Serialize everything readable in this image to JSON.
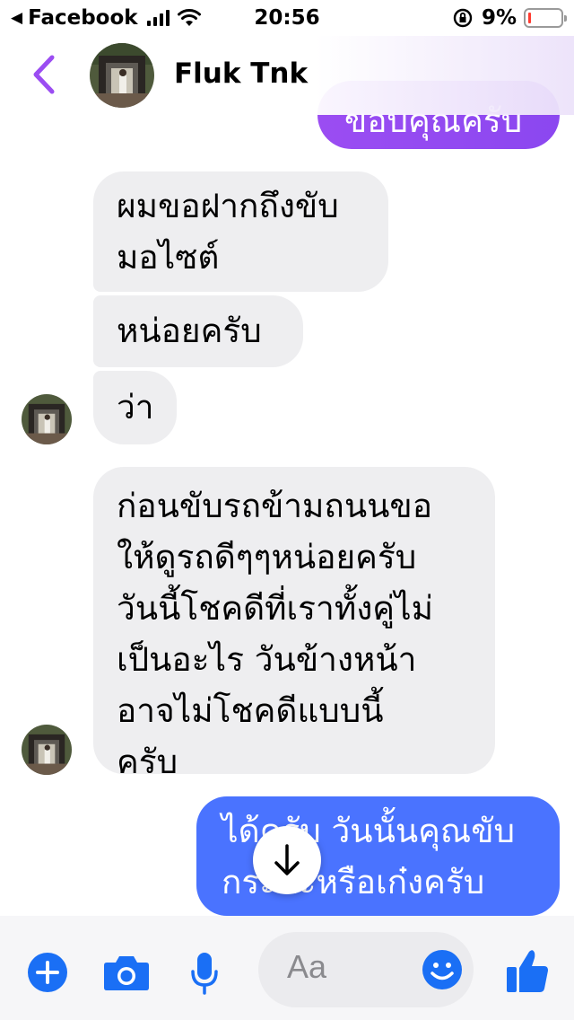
{
  "status_bar": {
    "carrier": "Facebook",
    "time": "20:56",
    "battery_percent": "9%",
    "battery_level": 0.09
  },
  "header": {
    "contact_name": "Fluk Tnk",
    "icons": {
      "back": "chevron-left-icon"
    }
  },
  "messages": [
    {
      "sender": "me",
      "text": "ขอบคุณครับ"
    },
    {
      "sender": "contact",
      "text": "ผมขอฝากถึงขับ\nมอไซต์"
    },
    {
      "sender": "contact",
      "text": "หน่อยครับ"
    },
    {
      "sender": "contact",
      "text": "ว่า"
    },
    {
      "sender": "contact",
      "text": "ก่อนขับรถข้ามถนนขอ\nให้ดูรถดีๆๆหน่อยครับ\nวันนี้โชคดีที่เราทั้งคู่ไม่\nเป็นอะไร วันข้างหน้า\nอาจไม่โชคดีแบบนี้\nครับ"
    },
    {
      "sender": "me",
      "text": "ได้ครับ วันนั้นคุณขับ\nกระบะหรือเก๋งครับ"
    }
  ],
  "composer": {
    "placeholder": "Aa",
    "icons": [
      "plus-icon",
      "camera-icon",
      "microphone-icon",
      "emoji-icon",
      "thumbs-up-icon"
    ]
  },
  "colors": {
    "incoming_bubble": "#eeeef0",
    "outgoing_purple": "#9b4df2",
    "outgoing_blue": "#4a73ff",
    "accent_icon": "#1a6ff5",
    "back_chevron": "#9b4df2"
  }
}
